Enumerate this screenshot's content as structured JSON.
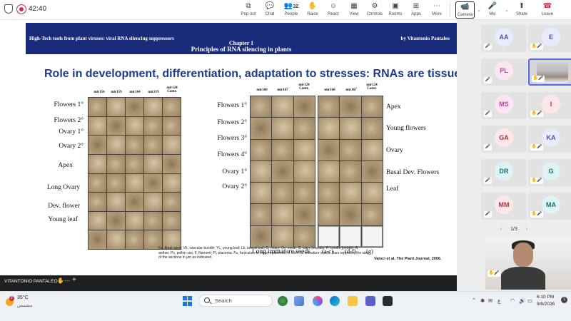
{
  "toolbar": {
    "timer": "42:40",
    "buttons": [
      {
        "name": "pop-out",
        "label": "Pop out",
        "icon": "⧉"
      },
      {
        "name": "chat",
        "label": "Chat",
        "icon": "💬"
      },
      {
        "name": "people",
        "label": "People",
        "icon": "👥",
        "count": "32"
      },
      {
        "name": "raise",
        "label": "Raise",
        "icon": "✋"
      },
      {
        "name": "react",
        "label": "React",
        "icon": "☺"
      },
      {
        "name": "view",
        "label": "View",
        "icon": "▦"
      },
      {
        "name": "controls",
        "label": "Controls",
        "icon": "⚙"
      },
      {
        "name": "rooms",
        "label": "Rooms",
        "icon": "▣"
      },
      {
        "name": "apps",
        "label": "Apps",
        "icon": "⊞"
      },
      {
        "name": "more",
        "label": "More",
        "icon": "⋯"
      },
      {
        "name": "camera",
        "label": "Camera",
        "icon": "📹"
      },
      {
        "name": "mic",
        "label": "Mic",
        "icon": "🎤"
      },
      {
        "name": "share",
        "label": "Share",
        "icon": "⬆"
      },
      {
        "name": "leave",
        "label": "Leave",
        "icon": "☎"
      }
    ]
  },
  "slide": {
    "header_left": "High-Tech tools from plant viruses: viral RNA silencing suppressors",
    "header_right": "by Vitantonio Pantaleo",
    "chapter": "Chapter 1",
    "subtitle": "Principles of RNA silencing in plants",
    "title": "Role in development, differentiation, adaptation to stresses: RNAs are tissue specific",
    "left_panel": {
      "columns": [
        "mir156",
        "mir159",
        "mir164",
        "mir319",
        "mir124\nContr."
      ],
      "rows": [
        "Flowers 1°",
        "Flowers 2°",
        "Ovary 1°",
        "Ovary 2°",
        "Apex",
        "Long Ovary",
        "Dev. flower",
        "Young leaf"
      ]
    },
    "right_panel": {
      "columns": [
        "mir160",
        "mir167",
        "mir124\nContr.",
        "mir160",
        "mir167",
        "mir124\nContr."
      ],
      "left_rows": [
        "Flowers 1°",
        "Flowers 2°",
        "Flowers 3°",
        "Flowers 4°",
        "Ovary 1°",
        "Ovary 2°"
      ],
      "right_rows": [
        "Apex",
        "Young flowers",
        "Ovary",
        "Basal Dev. Flowers",
        "Leaf"
      ],
      "bottom_labels": [
        "Long immature seeds",
        "(a-c)",
        "(d-f)",
        "(g)"
      ]
    },
    "legend": "Fa, floral apex; Vb, vascular bundle; YL, young leaf; Lb, lateral bud; O, ovary; Ov, ovule; S, calyx (sepals); P, corolla (petals); A, anther; Ps, pollen sac; F, filament; Pl, placenta; Fu, funiculus; Ie, inner epidermis; V, vein; Is, immature seeds. Bars represent the size of the sections in μm as indicated.",
    "citation": "Valoci et al, The Plant Journal, 2006."
  },
  "presenter": {
    "name": "VITANTONIO PANTALEO",
    "hand_icon": "✋",
    "menu_icon": "⋯",
    "plus_icon": "+"
  },
  "participants": {
    "tiles": [
      {
        "initials": "AA",
        "bg": "#e8ebfa",
        "fg": "#4f52b2"
      },
      {
        "initials": "E",
        "bg": "#e8ebfa",
        "fg": "#4f52b2"
      },
      {
        "initials": "PL",
        "bg": "#fce7f0",
        "fg": "#c239b3"
      },
      {
        "initials": "",
        "bg": "",
        "fg": ""
      },
      {
        "initials": "MS",
        "bg": "#fce7f0",
        "fg": "#c239b3"
      },
      {
        "initials": "I",
        "bg": "#fde7e9",
        "fg": "#a4373a"
      },
      {
        "initials": "GA",
        "bg": "#fde7e9",
        "fg": "#a4373a"
      },
      {
        "initials": "KA",
        "bg": "#e8ebfa",
        "fg": "#4f52b2"
      },
      {
        "initials": "DR",
        "bg": "#e0f2f1",
        "fg": "#03787c"
      },
      {
        "initials": "G",
        "bg": "#e0f2f1",
        "fg": "#03787c"
      },
      {
        "initials": "MM",
        "bg": "#fde7e9",
        "fg": "#a4373a"
      },
      {
        "initials": "MA",
        "bg": "#e0f2f1",
        "fg": "#03787c"
      }
    ],
    "pager": "1/3"
  },
  "taskbar": {
    "weather_temp": "35°C",
    "weather_desc": "مشمس",
    "weather_badge": "1",
    "search_label": "Search",
    "clock_time": "6:10 PM",
    "clock_date": "9/8/2026",
    "notif_count": "1",
    "tray_lang": "ع"
  }
}
